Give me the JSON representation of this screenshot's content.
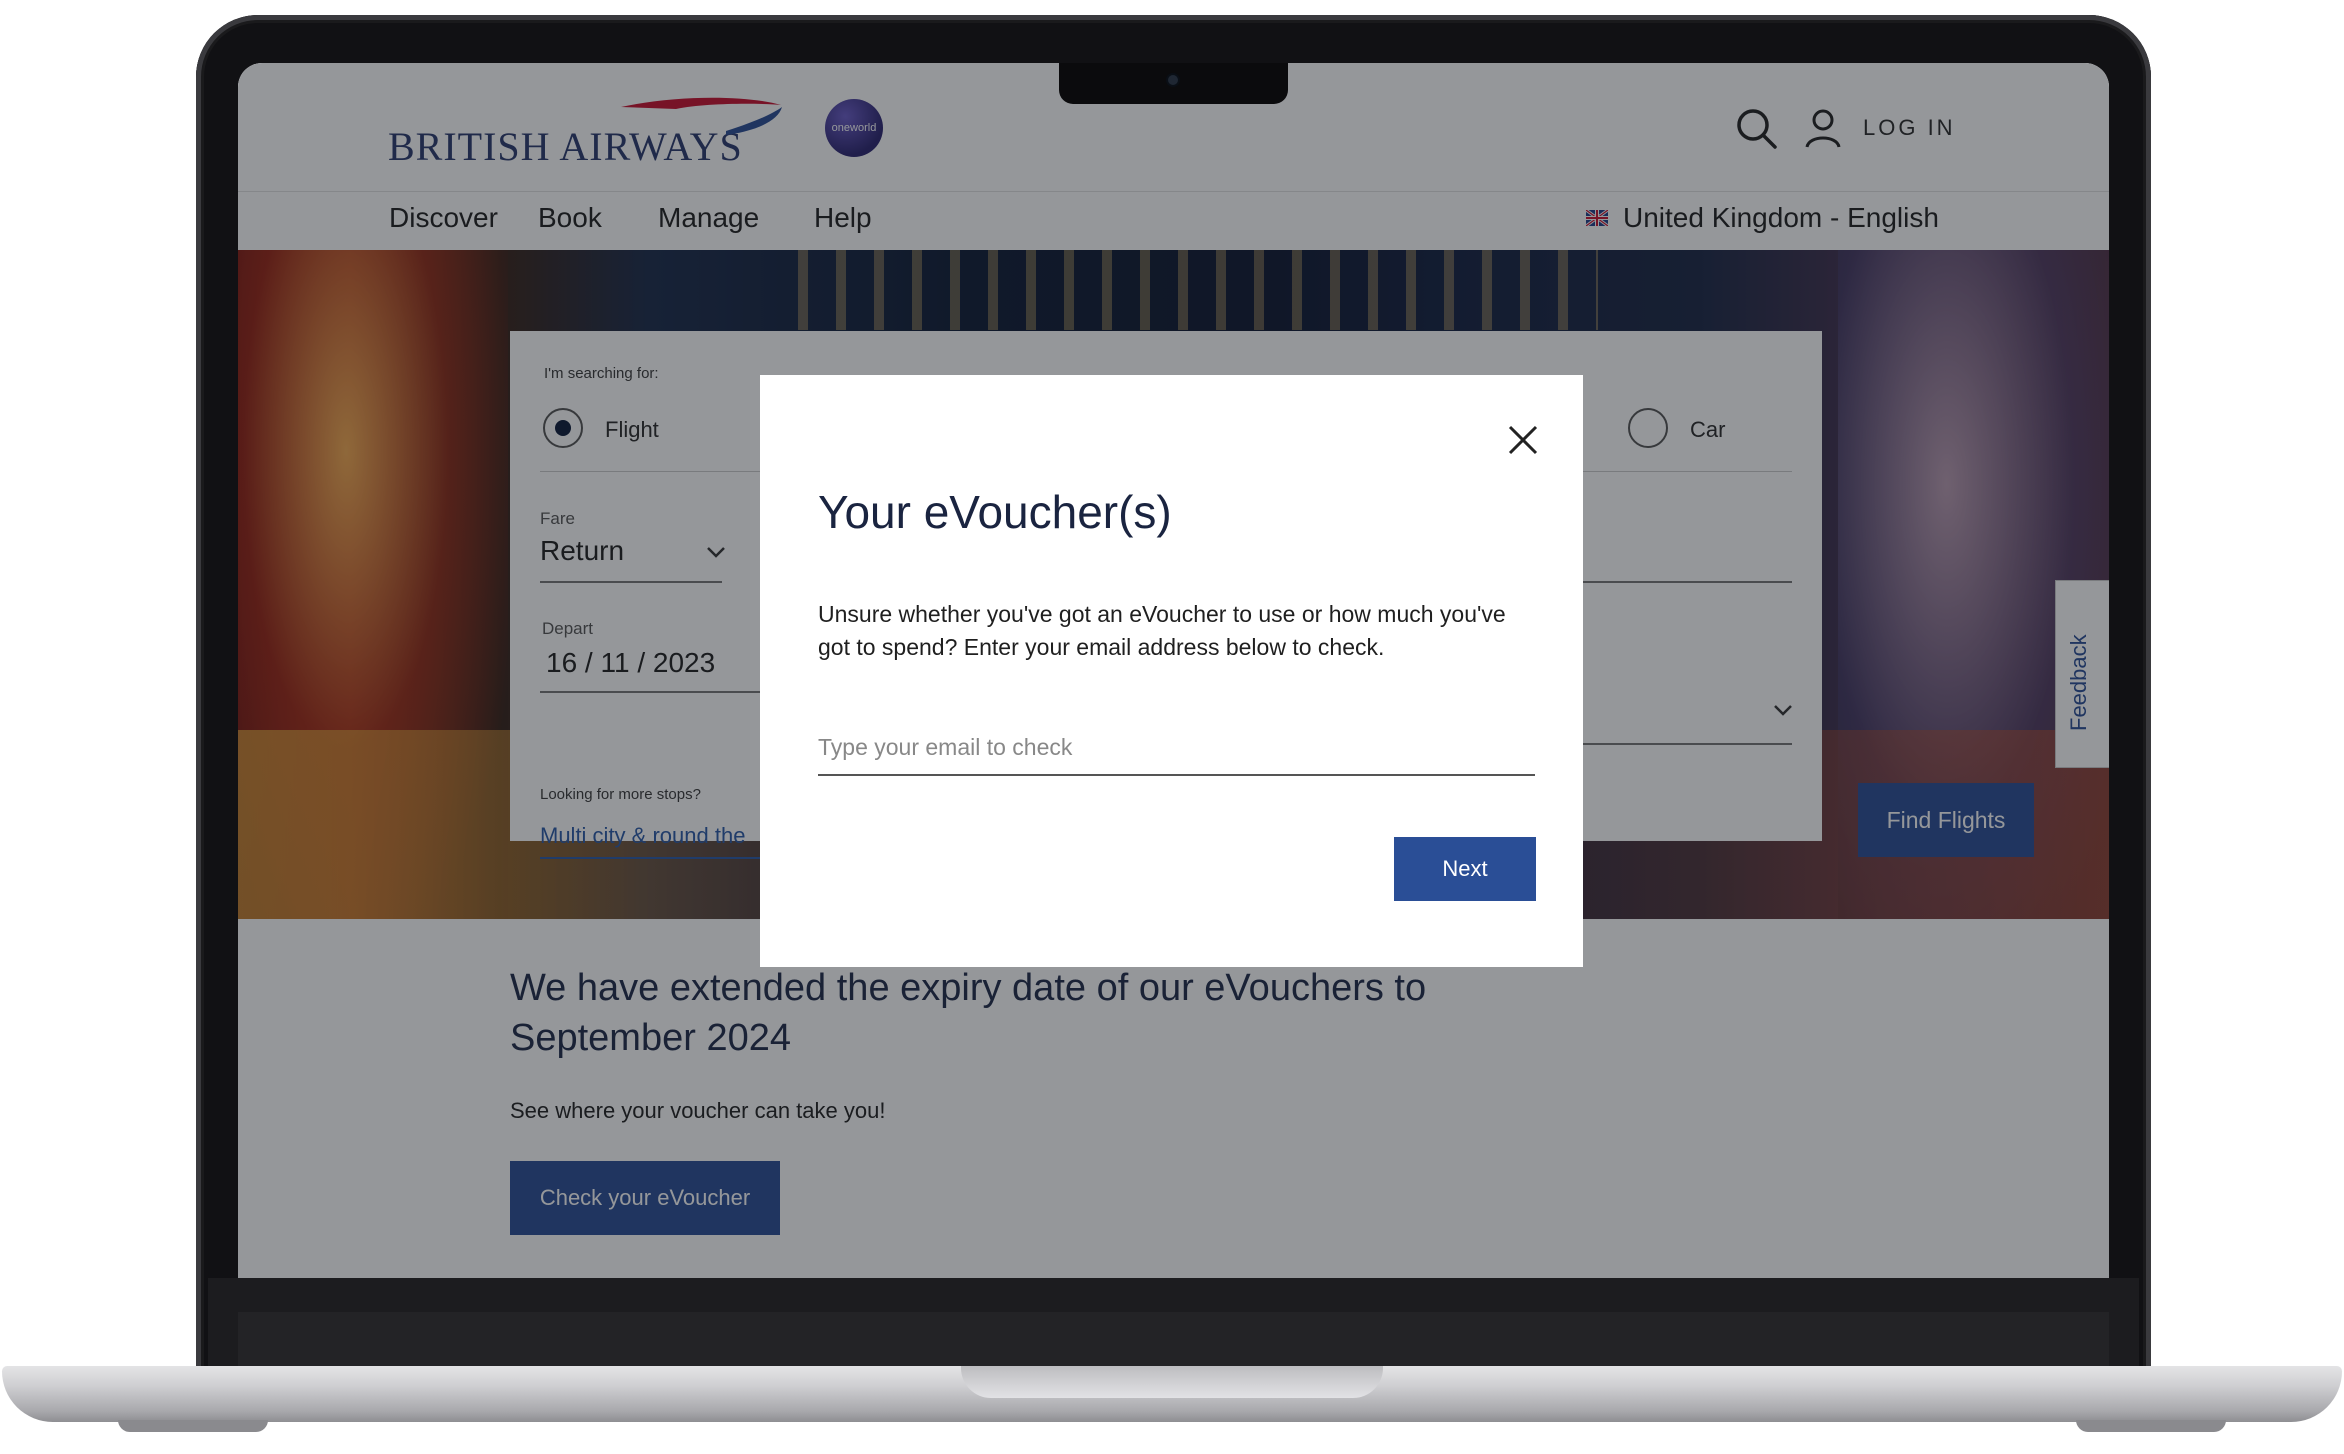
{
  "header": {
    "brand": "BRITISH AIRWAYS",
    "alliance_logo": "oneworld",
    "login_label": "LOG IN",
    "icons": [
      "search-icon",
      "user-icon"
    ]
  },
  "nav": {
    "items": [
      "Discover",
      "Book",
      "Manage",
      "Help"
    ],
    "region": "United Kingdom - English"
  },
  "search_panel": {
    "searching_for_label": "I'm searching for:",
    "options": [
      {
        "label": "Flight",
        "selected": true
      },
      {
        "label": "Car",
        "selected": false
      }
    ],
    "fare_label": "Fare",
    "fare_value": "Return",
    "depart_label": "Depart",
    "depart_value": "16 / 11 / 2023",
    "more_stops_label": "Looking for more stops?",
    "multi_city_link": "Multi city & round the",
    "find_flights_label": "Find Flights"
  },
  "feedback": {
    "label": "Feedback"
  },
  "promo": {
    "title": "We have extended the expiry date of our eVouchers to September 2024",
    "subtitle": "See where your voucher can take you!",
    "button_label": "Check your eVoucher"
  },
  "modal": {
    "title": "Your eVoucher(s)",
    "body": "Unsure whether you've got an eVoucher to use or how much you've got to spend? Enter your email address below to check.",
    "email_value": "",
    "email_placeholder": "Type your email to check",
    "next_label": "Next"
  },
  "colors": {
    "brand_blue": "#2a4e96",
    "title_navy": "#1a2440",
    "swoosh_red": "#c8102e"
  }
}
